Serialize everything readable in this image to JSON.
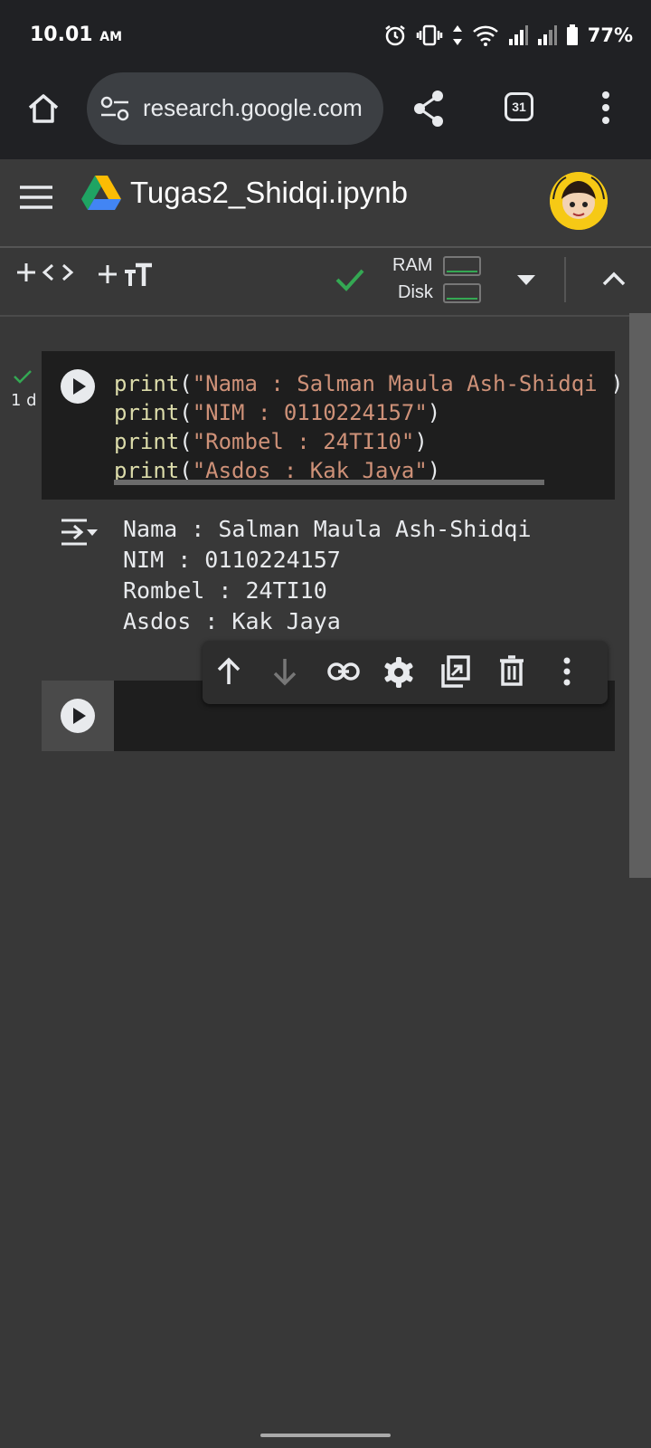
{
  "status_bar": {
    "time": "10.01",
    "ampm": "AM",
    "battery": "77%"
  },
  "browser": {
    "url": "research.google.com",
    "tab_count": "31"
  },
  "notebook": {
    "title": "Tugas2_Shidqi.ipynb",
    "ram_label": "RAM",
    "disk_label": "Disk"
  },
  "cell1": {
    "exec_time": "1 d",
    "code_lines": [
      {
        "fn": "print",
        "open": "(",
        "str": "\"Nama : Salman Maula Ash-Shidqi\"",
        "close": ")"
      },
      {
        "fn": "print",
        "open": "(",
        "str": "\"NIM : 0110224157\"",
        "close": ")"
      },
      {
        "fn": "print",
        "open": "(",
        "str": "\"Rombel : 24TI10\"",
        "close": ")"
      },
      {
        "fn": "print",
        "open": "(",
        "str": "\"Asdos : Kak Jaya\"",
        "close": ")"
      }
    ],
    "output_lines": [
      "Nama : Salman Maula Ash-Shidqi",
      "NIM : 0110224157",
      "Rombel : 24TI10",
      "Asdos : Kak Jaya"
    ]
  },
  "colors": {
    "accent_green": "#34a853",
    "string_color": "#ce9178",
    "function_color": "#dcdcaa"
  }
}
